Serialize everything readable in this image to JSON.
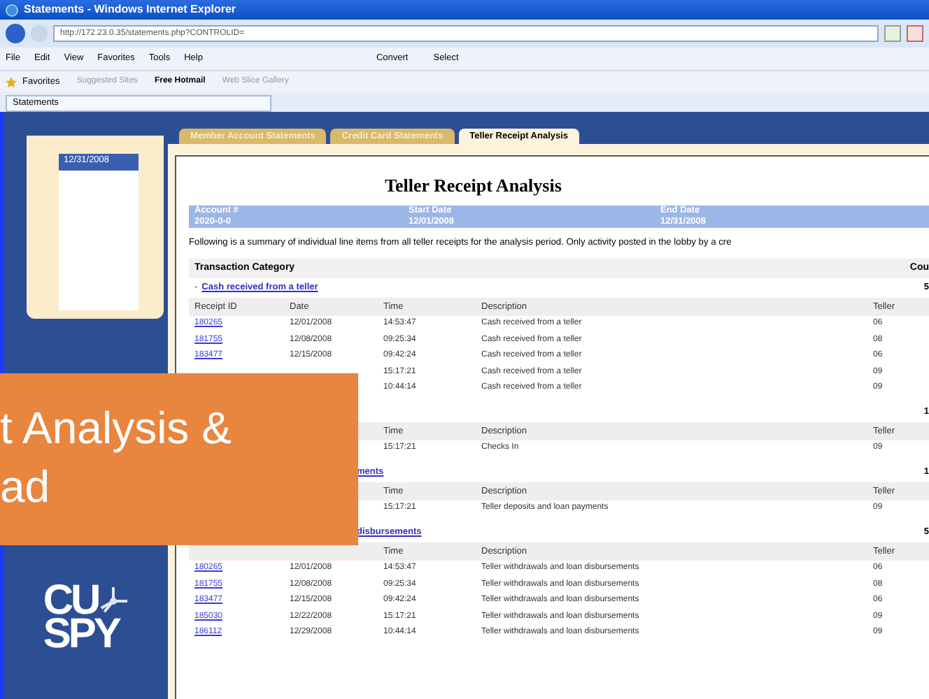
{
  "window": {
    "title": "Statements - Windows Internet Explorer"
  },
  "address_bar": {
    "url": "http://172.23.0.35/statements.php?CONTROLID="
  },
  "menu": [
    "File",
    "Edit",
    "View",
    "Favorites",
    "Tools",
    "Help"
  ],
  "command_buttons": [
    "Convert",
    "Select"
  ],
  "favorites_bar": {
    "label": "Favorites",
    "links": [
      "Suggested Sites",
      "Free Hotmail",
      "Web Slice Gallery"
    ]
  },
  "browser_tab": {
    "title": "Statements"
  },
  "sidebar": {
    "dates": [
      {
        "label": "12/31/2008",
        "selected": true
      }
    ],
    "logo": {
      "line1": "CU",
      "line2": "SPY"
    }
  },
  "page_tabs": [
    {
      "label": "Member Account Statements",
      "selected": false
    },
    {
      "label": "Credit Card Statements",
      "selected": false
    },
    {
      "label": "Teller Receipt Analysis",
      "selected": true
    }
  ],
  "report": {
    "title": "Teller Receipt Analysis",
    "info": [
      {
        "label": "Account #",
        "value": "2020-0-0"
      },
      {
        "label": "Start Date",
        "value": "12/01/2008"
      },
      {
        "label": "End Date",
        "value": "12/31/2008"
      }
    ],
    "summary": "Following is a summary of individual line items from all teller receipts for the analysis period. Only activity posted in the lobby by a cre",
    "category_header": "Transaction Category",
    "count_header": "Cou",
    "sections": [
      {
        "bullet": "-",
        "title": "Cash received from a teller",
        "count": "5",
        "header": {
          "receipt_id": "Receipt ID",
          "date": "Date",
          "time": "Time",
          "description": "Description",
          "teller": "Teller"
        },
        "rows": [
          {
            "receipt_id": "180265",
            "date": "12/01/2008",
            "time": "14:53:47",
            "description": "Cash received from a teller",
            "teller": "06"
          },
          {
            "receipt_id": "181755",
            "date": "12/08/2008",
            "time": "09:25:34",
            "description": "Cash received from a teller",
            "teller": "08"
          },
          {
            "receipt_id": "183477",
            "date": "12/15/2008",
            "time": "09:42:24",
            "description": "Cash received from a teller",
            "teller": "06"
          },
          {
            "time": "15:17:21",
            "description": "Cash received from a teller",
            "teller": "09"
          },
          {
            "time": "10:44:14",
            "description": "Cash received from a teller",
            "teller": "09"
          }
        ]
      },
      {
        "count": "1",
        "header": {
          "time": "Time",
          "description": "Description",
          "teller": "Teller"
        },
        "rows": [
          {
            "time": "15:17:21",
            "description": "Checks In",
            "teller": "09"
          }
        ]
      },
      {
        "title": "ments",
        "count": "1",
        "header": {
          "time": "Time",
          "description": "Description",
          "teller": "Teller"
        },
        "rows": [
          {
            "time": "15:17:21",
            "description": "Teller deposits and loan payments",
            "teller": "09"
          }
        ]
      },
      {
        "title": "disbursements",
        "count": "5",
        "header": {
          "time": "Time",
          "description": "Description",
          "teller": "Teller"
        },
        "rows": [
          {
            "receipt_id": "180265",
            "date": "12/01/2008",
            "time": "14:53:47",
            "description": "Teller withdrawals and loan disbursements",
            "teller": "06"
          },
          {
            "receipt_id": "181755",
            "date": "12/08/2008",
            "time": "09:25:34",
            "description": "Teller withdrawals and loan disbursements",
            "teller": "08"
          },
          {
            "receipt_id": "183477",
            "date": "12/15/2008",
            "time": "09:42:24",
            "description": "Teller withdrawals and loan disbursements",
            "teller": "06"
          },
          {
            "receipt_id": "185030",
            "date": "12/22/2008",
            "time": "15:17:21",
            "description": "Teller withdrawals and loan disbursements",
            "teller": "09"
          },
          {
            "receipt_id": "186112",
            "date": "12/29/2008",
            "time": "10:44:14",
            "description": "Teller withdrawals and loan disbursements",
            "teller": "09"
          }
        ]
      }
    ]
  },
  "overlay_banner": {
    "lines": [
      "t Analysis &",
      "ad"
    ]
  }
}
